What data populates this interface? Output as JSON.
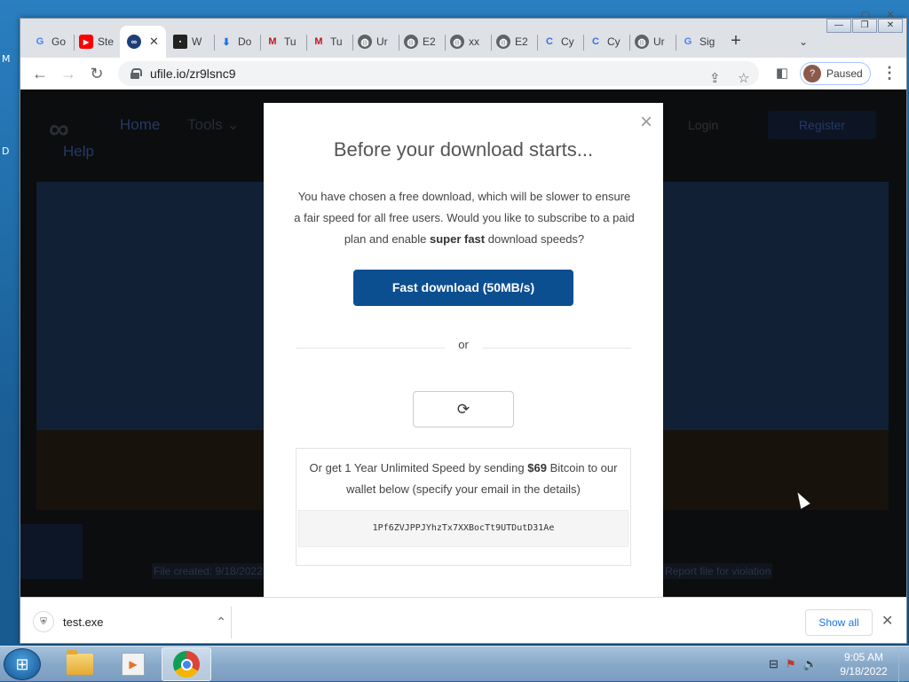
{
  "desktop": {
    "letters": [
      "M",
      "D"
    ]
  },
  "browser": {
    "tabs": [
      {
        "label": "Go",
        "icon": "google-icon"
      },
      {
        "label": "Ste",
        "icon": "youtube-icon"
      },
      {
        "label": "",
        "icon": "ufile-icon",
        "active": true
      },
      {
        "label": "W",
        "icon": "site-icon"
      },
      {
        "label": "Do",
        "icon": "download-icon"
      },
      {
        "label": "Tu",
        "icon": "mcafee-icon"
      },
      {
        "label": "Tu",
        "icon": "mcafee-icon"
      },
      {
        "label": "Ur",
        "icon": "globe-icon"
      },
      {
        "label": "E2",
        "icon": "globe-icon"
      },
      {
        "label": "xx",
        "icon": "globe-icon"
      },
      {
        "label": "E2",
        "icon": "globe-icon"
      },
      {
        "label": "Cy",
        "icon": "cyber-icon"
      },
      {
        "label": "Cy",
        "icon": "cyber-icon"
      },
      {
        "label": "Ur",
        "icon": "globe-icon"
      },
      {
        "label": "Sig",
        "icon": "google-icon"
      }
    ],
    "url": "ufile.io/zr9lsnc9",
    "profile_status": "Paused",
    "profile_avatar": "?"
  },
  "site": {
    "nav_home": "Home",
    "nav_tools": "Tools ⌄",
    "nav_help": "Help",
    "login": "Login",
    "register": "Register",
    "footer_left": "File created: 9/18/2022",
    "footer_right": "Report file for violation"
  },
  "modal": {
    "title": "Before your download starts...",
    "text_part1": "You have chosen a free download, which will be slower to ensure a fair speed for all free users. Would you like to subscribe to a paid plan and enable ",
    "text_bold": "super fast",
    "text_part2": " download speeds?",
    "fast_button": "Fast download (50MB/s)",
    "or_label": "or",
    "btc_part1": "Or get 1 Year Unlimited Speed by sending ",
    "btc_price": "$69",
    "btc_part2": " Bitcoin to our wallet below (specify your email in the details)",
    "btc_wallet": "1Pf6ZVJPPJYhzTx7XXBocTt9UTDutD31Ae"
  },
  "downloads": {
    "file": "test.exe",
    "show_all": "Show all"
  },
  "taskbar": {
    "time": "9:05 AM",
    "date": "9/18/2022"
  }
}
